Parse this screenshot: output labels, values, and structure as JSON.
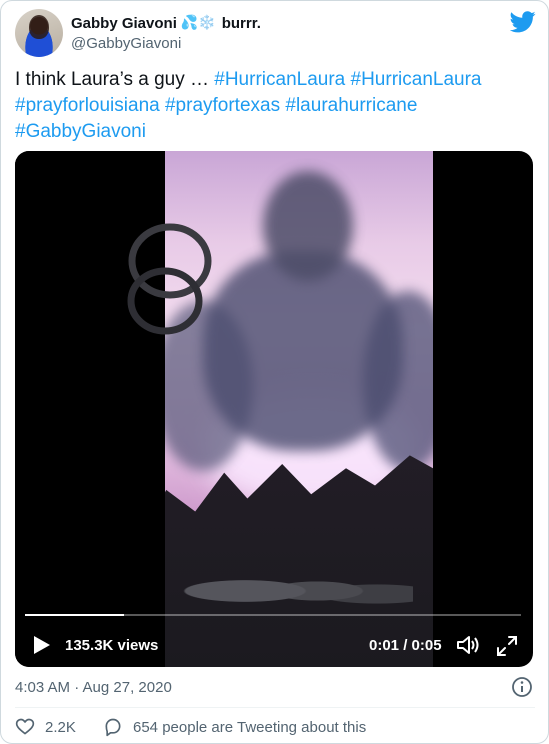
{
  "author": {
    "display_name": "Gabby Giavoni",
    "name_emojis": "💦❄️",
    "name_suffix": "burrr.",
    "handle": "@GabbyGiavoni"
  },
  "tweet": {
    "text_plain": "I think Laura’s a guy … ",
    "hashtags": [
      "#HurricanLaura",
      "#HurricanLaura",
      "#prayforlouisiana",
      "#prayfortexas",
      "#laurahurricane",
      "#GabbyGiavoni"
    ]
  },
  "video": {
    "views": "135.3K views",
    "time": "0:01 / 0:05",
    "progress": 0.2
  },
  "meta": {
    "timestamp": "4:03 AM · Aug 27, 2020"
  },
  "actions": {
    "likes": "2.2K",
    "conversation": "654 people are Tweeting about this"
  },
  "colors": {
    "brand": "#1d9bf0",
    "text": "#0f1419",
    "secondary": "#536471",
    "border": "#cfd9de"
  },
  "icons": [
    "twitter-bird-icon",
    "play-icon",
    "volume-icon",
    "fullscreen-icon",
    "info-icon",
    "heart-icon",
    "reply-icon"
  ]
}
